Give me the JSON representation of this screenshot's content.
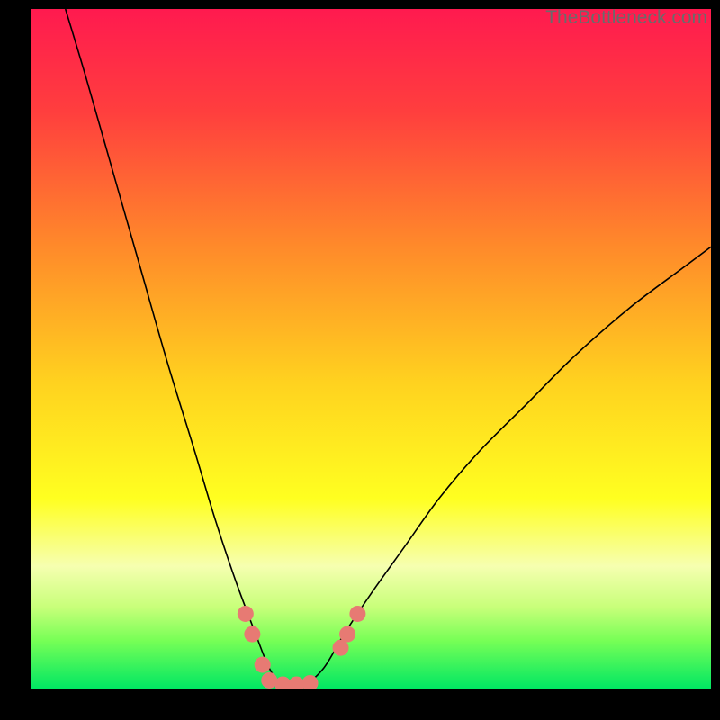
{
  "watermark": "TheBottleneck.com",
  "chart_data": {
    "type": "line",
    "title": "",
    "xlabel": "",
    "ylabel": "",
    "xlim": [
      0,
      100
    ],
    "ylim": [
      0,
      100
    ],
    "background": {
      "type": "vertical-gradient",
      "stops": [
        {
          "offset": 0,
          "color": "#ff1a4f"
        },
        {
          "offset": 0.15,
          "color": "#ff3e3e"
        },
        {
          "offset": 0.35,
          "color": "#ff8a2a"
        },
        {
          "offset": 0.55,
          "color": "#ffd21f"
        },
        {
          "offset": 0.72,
          "color": "#ffff20"
        },
        {
          "offset": 0.82,
          "color": "#f6ffb0"
        },
        {
          "offset": 0.88,
          "color": "#c8ff7a"
        },
        {
          "offset": 0.93,
          "color": "#76ff56"
        },
        {
          "offset": 1.0,
          "color": "#00e763"
        }
      ]
    },
    "series": [
      {
        "name": "bottleneck-curve",
        "color": "#000000",
        "width": 1.6,
        "points": [
          {
            "x": 5,
            "y": 100
          },
          {
            "x": 8,
            "y": 90
          },
          {
            "x": 12,
            "y": 76
          },
          {
            "x": 16,
            "y": 62
          },
          {
            "x": 20,
            "y": 48
          },
          {
            "x": 24,
            "y": 35
          },
          {
            "x": 27,
            "y": 25
          },
          {
            "x": 30,
            "y": 16
          },
          {
            "x": 33,
            "y": 8
          },
          {
            "x": 35,
            "y": 3
          },
          {
            "x": 37,
            "y": 0.5
          },
          {
            "x": 40,
            "y": 0.5
          },
          {
            "x": 43,
            "y": 3
          },
          {
            "x": 46,
            "y": 8
          },
          {
            "x": 50,
            "y": 14
          },
          {
            "x": 55,
            "y": 21
          },
          {
            "x": 60,
            "y": 28
          },
          {
            "x": 66,
            "y": 35
          },
          {
            "x": 73,
            "y": 42
          },
          {
            "x": 80,
            "y": 49
          },
          {
            "x": 88,
            "y": 56
          },
          {
            "x": 96,
            "y": 62
          },
          {
            "x": 100,
            "y": 65
          }
        ]
      }
    ],
    "markers": {
      "color": "#e77a73",
      "radius": 9,
      "points": [
        {
          "x": 31.5,
          "y": 11
        },
        {
          "x": 32.5,
          "y": 8
        },
        {
          "x": 34,
          "y": 3.5
        },
        {
          "x": 35,
          "y": 1.2
        },
        {
          "x": 37,
          "y": 0.6
        },
        {
          "x": 39,
          "y": 0.6
        },
        {
          "x": 41,
          "y": 0.8
        },
        {
          "x": 45.5,
          "y": 6
        },
        {
          "x": 46.5,
          "y": 8
        },
        {
          "x": 48,
          "y": 11
        }
      ]
    }
  }
}
